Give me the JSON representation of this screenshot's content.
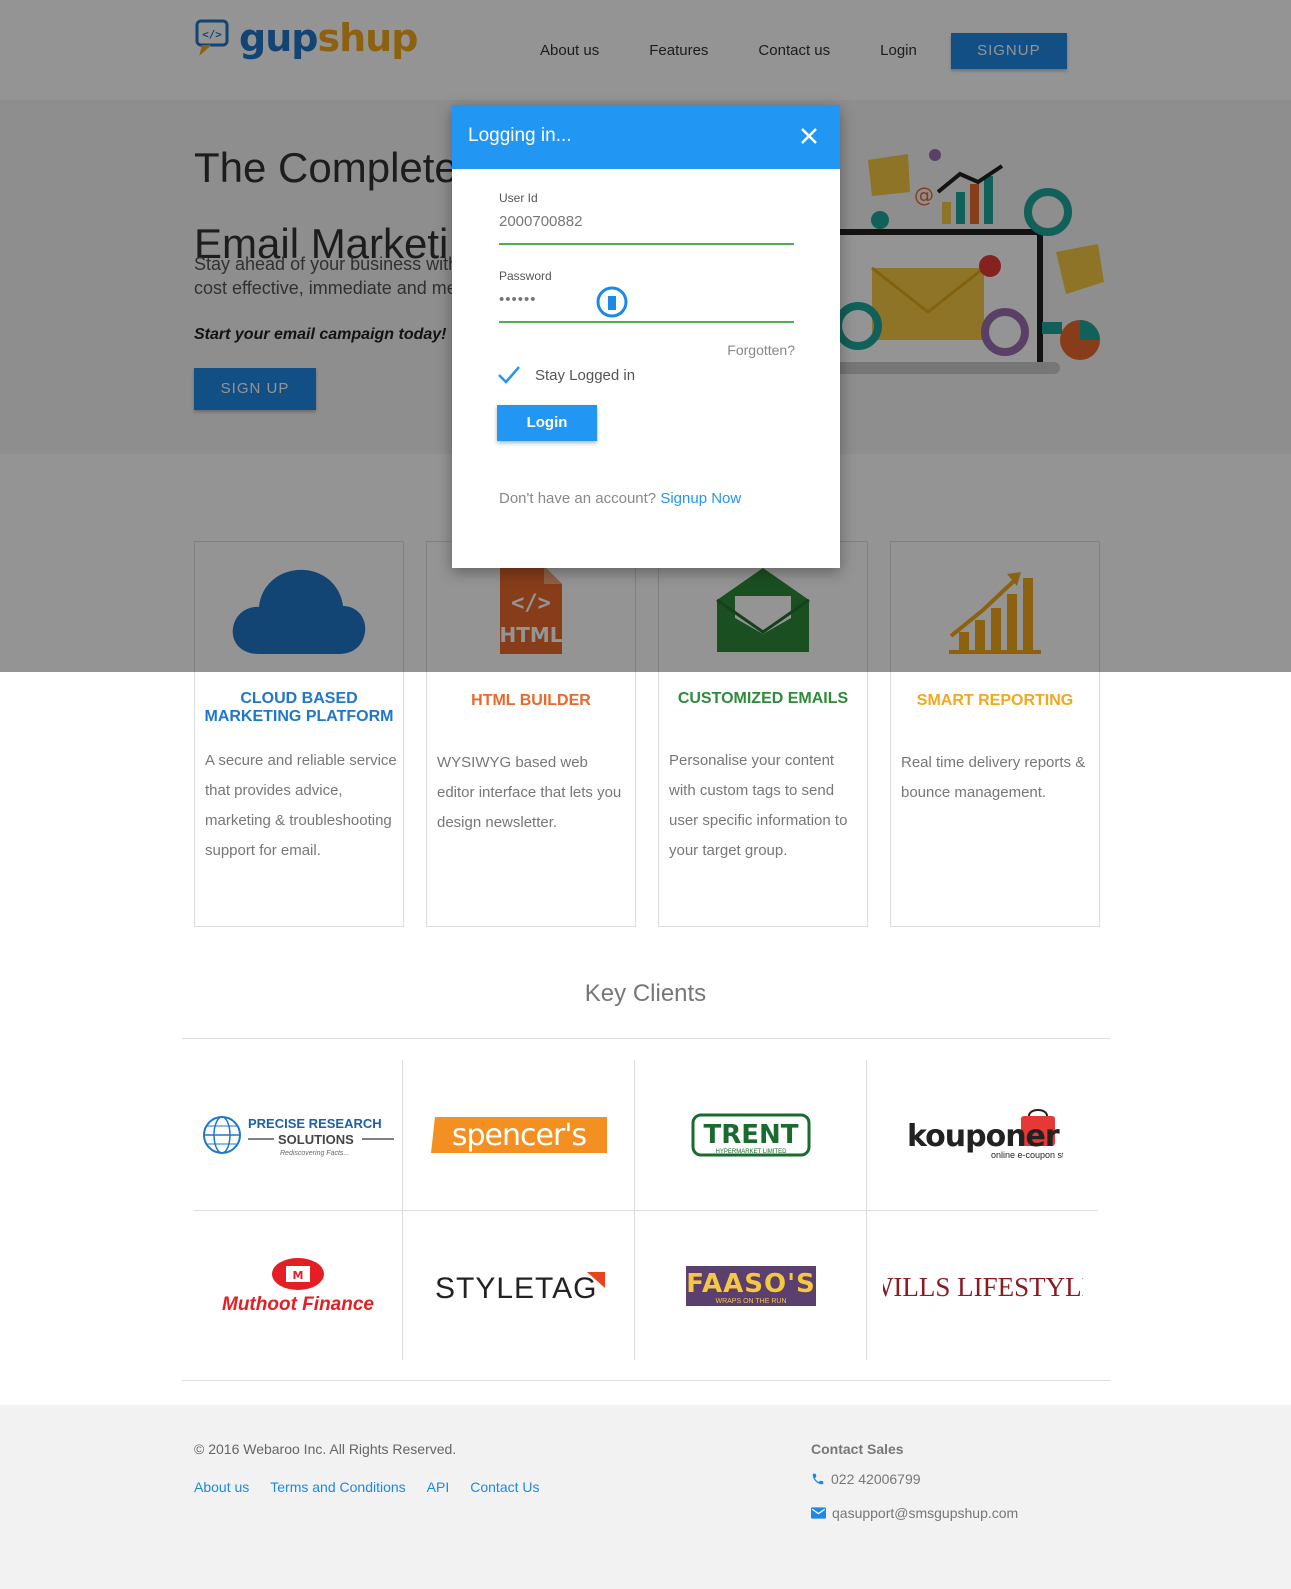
{
  "brand": {
    "part1": "gup",
    "part2": "shup"
  },
  "nav": {
    "about": "About us",
    "features": "Features",
    "contact": "Contact us",
    "login": "Login",
    "signup": "SIGNUP"
  },
  "hero": {
    "title_line1": "The Complete",
    "title_line2": "Email Marketi",
    "subtitle_line1": "Stay ahead of your business with",
    "subtitle_line2": "cost effective, immediate and me",
    "cta_text": "Start your email campaign today!",
    "button": "SIGN UP"
  },
  "features": [
    {
      "title_line1": "CLOUD BASED",
      "title_line2": "MARKETING PLATFORM",
      "text": "A secure and reliable service that provides advice, marketing & troubleshooting support for email.",
      "color": "#1f77c8",
      "icon": "cloud-icon"
    },
    {
      "title_line1": "HTML BUILDER",
      "title_line2": "",
      "text": "WYSIWYG based web editor interface that lets you design newsletter.",
      "color": "#e8692b",
      "icon": "html-file-icon"
    },
    {
      "title_line1": "CUSTOMIZED EMAILS",
      "title_line2": "",
      "text": "Personalise your content with custom tags to send user specific information to your target group.",
      "color": "#2e8b3a",
      "icon": "open-envelope-icon"
    },
    {
      "title_line1": "SMART REPORTING",
      "title_line2": "",
      "text": "Real time delivery reports & bounce management.",
      "color": "#f2a81d",
      "icon": "bar-chart-icon"
    }
  ],
  "modal": {
    "title": "Logging in...",
    "user_label": "User Id",
    "user_value": "2000700882",
    "password_label": "Password",
    "password_value": "••••••",
    "forgot": "Forgotten?",
    "stay_logged": "Stay Logged in",
    "login_button": "Login",
    "no_account": "Don't have an account?",
    "signup_link": "Signup Now"
  },
  "clients": {
    "title": "Key Clients",
    "logos": {
      "precise_1": "PRECISE RESEARCH",
      "precise_2": "SOLUTIONS",
      "precise_3": "Rediscovering Facts...",
      "spencers": "spencer's",
      "trent": "TRENT",
      "trent_sub": "HYPERMARKET LIMITED",
      "kouponer": "kouponer",
      "kouponer_sub": "online e-coupon store",
      "muthoot": "Muthoot Finance",
      "styletag": "STYLETAG",
      "faasos": "FAASO'S",
      "faasos_sub": "WRAPS ON THE RUN",
      "wills": "WILLS LIFESTYLE"
    }
  },
  "footer": {
    "copyright": "© 2016 Webaroo Inc. All Rights Reserved.",
    "links": [
      "About us",
      "Terms and Conditions",
      "API",
      "Contact Us"
    ],
    "contact_title": "Contact Sales",
    "phone": "022 42006799",
    "email": "qasupport@smsgupshup.com"
  }
}
